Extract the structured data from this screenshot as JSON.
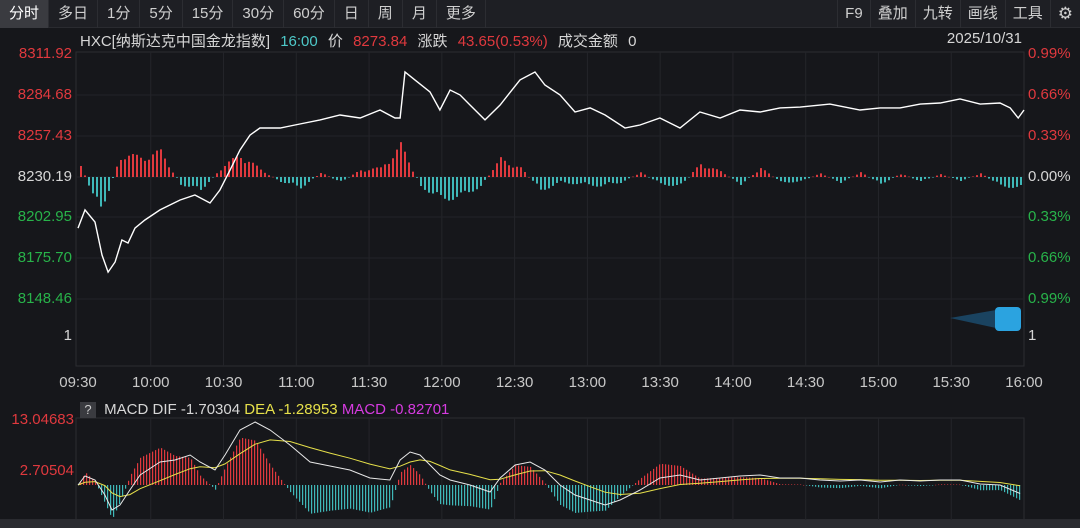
{
  "toolbar": {
    "tabs": [
      "分时",
      "多日",
      "1分",
      "5分",
      "15分",
      "30分",
      "60分",
      "日",
      "周",
      "月",
      "更多"
    ],
    "right": [
      "F9",
      "叠加",
      "九转",
      "画线",
      "工具"
    ],
    "settings_icon": "gear-icon"
  },
  "info": {
    "code_name": "HXC[纳斯达克中国金龙指数]",
    "time": "16:00",
    "price_label": "价",
    "price": "8273.84",
    "change_label": "涨跌",
    "change": "43.65(0.53%)",
    "turnover_label": "成交金额",
    "turnover": "0",
    "date": "2025/10/31"
  },
  "axis": {
    "left": [
      "8311.92",
      "8284.68",
      "8257.43",
      "8230.19",
      "8202.95",
      "8175.70",
      "8148.46",
      "1"
    ],
    "right": [
      "0.99%",
      "0.66%",
      "0.33%",
      "0.00%",
      "0.33%",
      "0.66%",
      "0.99%",
      "1"
    ],
    "times": [
      "09:30",
      "10:00",
      "10:30",
      "11:00",
      "11:30",
      "12:00",
      "12:30",
      "13:00",
      "13:30",
      "14:00",
      "14:30",
      "15:00",
      "15:30",
      "16:00"
    ]
  },
  "macd": {
    "help": "?",
    "dif_label": "MACD DIF",
    "dif": "-1.70304",
    "dea_label": "DEA",
    "dea": "-1.28953",
    "macd_label": "MACD",
    "macd": "-0.82701",
    "axis": [
      "13.04683",
      "2.70504"
    ]
  },
  "colors": {
    "up": "#e0393e",
    "down": "#3fb8b8",
    "price_line": "#ffffff",
    "dif": "#e8e8e8",
    "dea": "#e6e04a",
    "macd": "#d63be0"
  },
  "chart_data": {
    "type": "line",
    "ylim": [
      8148.46,
      8311.92
    ],
    "base": 8230.19,
    "price": [
      [
        0,
        8196.1
      ],
      [
        2.9,
        8208.2
      ],
      [
        7,
        8200.1
      ],
      [
        9.9,
        8178.1
      ],
      [
        12.4,
        8166.7
      ],
      [
        15.3,
        8173.4
      ],
      [
        18.1,
        8188.1
      ],
      [
        20.6,
        8186.1
      ],
      [
        23.5,
        8196.1
      ],
      [
        27.6,
        8201.5
      ],
      [
        33.8,
        8208.2
      ],
      [
        37.9,
        8211.5
      ],
      [
        42.1,
        8214.8
      ],
      [
        48.2,
        8218.2
      ],
      [
        54.4,
        8212.8
      ],
      [
        58.5,
        8221.5
      ],
      [
        62.7,
        8234.9
      ],
      [
        66.8,
        8248.2
      ],
      [
        70.9,
        8258.2
      ],
      [
        75,
        8262.9
      ],
      [
        83.3,
        8262.9
      ],
      [
        91.5,
        8265.6
      ],
      [
        99.8,
        8268.3
      ],
      [
        108,
        8271.6
      ],
      [
        116.3,
        8269.6
      ],
      [
        124.5,
        8274.9
      ],
      [
        130.7,
        8269.6
      ],
      [
        132.8,
        8269.6
      ],
      [
        134.8,
        8300.3
      ],
      [
        138.9,
        8295
      ],
      [
        145.1,
        8287
      ],
      [
        149.2,
        8274.9
      ],
      [
        153.4,
        8288.3
      ],
      [
        157.5,
        8285
      ],
      [
        161.6,
        8278.3
      ],
      [
        167.8,
        8268.3
      ],
      [
        174,
        8278.3
      ],
      [
        182.2,
        8295
      ],
      [
        188.4,
        8300.3
      ],
      [
        192.5,
        8291.6
      ],
      [
        198.7,
        8285
      ],
      [
        204.9,
        8273.6
      ],
      [
        211.1,
        8276.3
      ],
      [
        217.3,
        8271.6
      ],
      [
        225.5,
        8262.9
      ],
      [
        231.7,
        8264.9
      ],
      [
        239.9,
        8269.6
      ],
      [
        248.2,
        8262.9
      ],
      [
        256.4,
        8273.6
      ],
      [
        264.7,
        8269.6
      ],
      [
        272.9,
        8274.9
      ],
      [
        281.2,
        8273.6
      ],
      [
        289.4,
        8276.3
      ],
      [
        297.7,
        8276.9
      ],
      [
        310,
        8278.9
      ],
      [
        322.4,
        8274.9
      ],
      [
        330.7,
        8276.3
      ],
      [
        338.9,
        8276.3
      ],
      [
        347.2,
        8278.9
      ],
      [
        355.4,
        8279.6
      ],
      [
        363.6,
        8282.3
      ],
      [
        371.9,
        8278.9
      ],
      [
        380.1,
        8279.6
      ],
      [
        384.3,
        8276.3
      ],
      [
        387.6,
        8269.6
      ],
      [
        390,
        8274.9
      ]
    ],
    "bars": [
      12,
      -40,
      25,
      22,
      28,
      -8,
      -15,
      10,
      25,
      8,
      -5,
      -12,
      5,
      -6,
      8,
      10,
      35,
      -10,
      -25,
      -22,
      -10,
      20,
      10,
      -15,
      -6,
      -8,
      -10,
      -6,
      5,
      -8,
      -10,
      15,
      6,
      -8,
      10,
      -6,
      -5,
      4,
      -6,
      5,
      -8,
      4,
      -5,
      3,
      -4,
      4,
      -10,
      -12
    ],
    "dif": [
      [
        0,
        0
      ],
      [
        2.9,
        1.81
      ],
      [
        7,
        1.0
      ],
      [
        11.1,
        -2.0
      ],
      [
        14,
        -5.02
      ],
      [
        17.3,
        -4.02
      ],
      [
        21.4,
        -1.0
      ],
      [
        25.6,
        2.0
      ],
      [
        33.8,
        4.62
      ],
      [
        40,
        5.02
      ],
      [
        46.2,
        6.02
      ],
      [
        50.3,
        4.62
      ],
      [
        56.5,
        3.01
      ],
      [
        60.6,
        6.02
      ],
      [
        66.8,
        11.04
      ],
      [
        73,
        12.65
      ],
      [
        79.2,
        11.04
      ],
      [
        87.4,
        8.03
      ],
      [
        95.7,
        4.62
      ],
      [
        103.9,
        3.82
      ],
      [
        112.1,
        3.01
      ],
      [
        120.4,
        1.41
      ],
      [
        128.6,
        1.0
      ],
      [
        132.8,
        5.02
      ],
      [
        136.9,
        6.63
      ],
      [
        141,
        6.02
      ],
      [
        145.1,
        4.02
      ],
      [
        149.2,
        2.0
      ],
      [
        153.4,
        1.0
      ],
      [
        161.6,
        0
      ],
      [
        169.9,
        -1.41
      ],
      [
        174,
        1.41
      ],
      [
        180.2,
        4.02
      ],
      [
        186.4,
        4.62
      ],
      [
        192.5,
        3.01
      ],
      [
        198.7,
        0
      ],
      [
        204.9,
        -2.0
      ],
      [
        211.1,
        -3.01
      ],
      [
        217.3,
        -4.02
      ],
      [
        223.5,
        -3.01
      ],
      [
        231.7,
        -1.0
      ],
      [
        239.9,
        1.41
      ],
      [
        248.2,
        2.0
      ],
      [
        256.4,
        1.0
      ],
      [
        264.7,
        1.41
      ],
      [
        272.9,
        1.81
      ],
      [
        281.2,
        2.0
      ],
      [
        289.4,
        1.41
      ],
      [
        297.7,
        1.41
      ],
      [
        305.9,
        1.0
      ],
      [
        314.2,
        0.8
      ],
      [
        322.4,
        1.0
      ],
      [
        330.7,
        0.6
      ],
      [
        338.9,
        1.0
      ],
      [
        347.2,
        0.8
      ],
      [
        355.4,
        1.0
      ],
      [
        363.6,
        1.0
      ],
      [
        371.9,
        0.2
      ],
      [
        380.1,
        0
      ],
      [
        388.4,
        -1.7
      ]
    ]
  }
}
